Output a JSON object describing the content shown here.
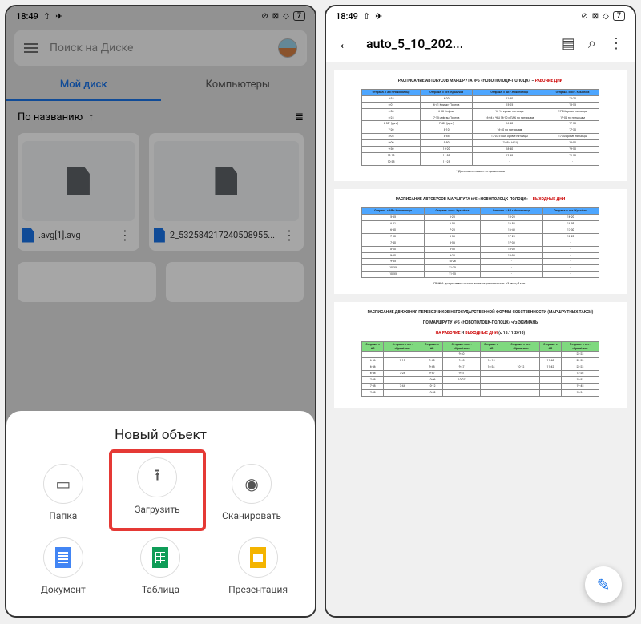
{
  "status": {
    "time": "18:49",
    "battery": "7"
  },
  "drive": {
    "search_placeholder": "Поиск на Диске",
    "tabs": {
      "mydisk": "Мой диск",
      "computers": "Компьютеры"
    },
    "sort_label": "По названию",
    "files": [
      {
        "name": ".avg[1].avg"
      },
      {
        "name": "2_532584217240508955..."
      }
    ]
  },
  "sheet": {
    "title": "Новый объект",
    "items": {
      "folder": "Папка",
      "upload": "Загрузить",
      "scan": "Сканировать",
      "doc": "Документ",
      "table": "Таблица",
      "presentation": "Презентация"
    }
  },
  "viewer": {
    "filename": "auto_5_10_202...",
    "page1": {
      "title_a": "РАСПИСАНИЕ АВТОБУСОВ МАРШРУТА №5 «НОВОПОЛОЦК-ПОЛОЦК» – ",
      "title_b": "РАБОЧИЕ ДНИ",
      "headers": [
        "Отправл. с АВ г.Новополоцк",
        "Отправл. с ост. Крынiчка",
        "Отправл. с АВ г.Новополоцк",
        "Отправл. с ост. Крынiчка"
      ],
      "rows": [
        [
          "5-35",
          "6-20",
          "11-30",
          "12-20"
        ],
        [
          "6-01",
          "6-41 Климо- Почтов",
          "15-05",
          "15-55"
        ],
        [
          "6-08",
          "6-58 Нефтан",
          "16-14 кроме пятницы",
          "17-04 кроме пятницы"
        ],
        [
          "6-25",
          "7-15 нефтан Почтов",
          "16-04 с ЧЩ 16-10 с ПАК по пятницам",
          "17-04 по пятницам"
        ],
        [
          "6-50* (дач.)",
          "7-40* (дач.)",
          "16-40",
          "17-30"
        ],
        [
          "7-20",
          "8-10",
          "16-40 по пятницам",
          "17-30"
        ],
        [
          "8-05",
          "8-55",
          "17-07 с ПАК кроме пятницы",
          "17-30 кроме пятницы"
        ],
        [
          "9-00",
          "9-50",
          "17-05 с НГЩ",
          "18-00"
        ],
        [
          "9-30",
          "10-20",
          "18-40",
          "19-50"
        ],
        [
          "10-10",
          "11-00",
          "19-30",
          "19-50"
        ],
        [
          "10-35",
          "11-25",
          "-",
          "-"
        ]
      ],
      "footnote": "* Дополнительные отправления"
    },
    "page2": {
      "title_a": "РАСПИСАНИЕ АВТОБУСОВ МАРШРУТА №5 «НОВОПОЛОЦК-ПОЛОЦК» – ",
      "title_b": "ВЫХОДНЫЕ ДНИ",
      "rows": [
        [
          "5-35",
          "6-20",
          "15-20",
          "16-20"
        ],
        [
          "6-01",
          "6-50",
          "16-00",
          "16-50"
        ],
        [
          "6-30",
          "7-20",
          "16-40",
          "17-30"
        ],
        [
          "7-00",
          "8-35",
          "17-20",
          "18-20"
        ],
        [
          "7-40",
          "8-53",
          "17-30",
          "-"
        ],
        [
          "8-00",
          "8-50",
          "18-00",
          "-"
        ],
        [
          "9-30",
          "9-20",
          "18-50",
          "-"
        ],
        [
          "9-35",
          "10-26",
          "-",
          "-"
        ],
        [
          "10-35",
          "11-25",
          "-",
          "-"
        ],
        [
          "10-55",
          "11-55",
          "-",
          "-"
        ]
      ],
      "footnote": "ПРИМ: допустимое отклонение от расписания: +3 мин;-5 мин."
    },
    "page3": {
      "title_a": "РАСПИСАНИЕ ДВИЖЕНИЯ ПЕРЕВОЗЧИКОВ НЕГОСУДАРСТВЕННОЙ ФОРМЫ СОБСТВЕННОСТИ (МАРШРУТНЫХ ТАКСИ)",
      "title_b": "ПО МАРШРУТУ №5 «НОВОПОЛОЦК-ПОЛОЦК» ч/з ЭКИМАНЬ",
      "title_c": "НА РАБОЧИЕ И ВЫХОДНЫЕ ДНИ (с 15.11.2018)",
      "headers": [
        "Отправл. с АВ",
        "Отправл. с ост. «Крынiчка»",
        "Отправл. с АВ",
        "Отправл. с ост. «Крынiчка»",
        "Отправл. с АВ",
        "Отправл. с ост. «Крынiчка»",
        "Отправл. с АВ",
        "Отправл. с ост. «Крынiчка»"
      ],
      "rows": [
        [
          "",
          "",
          "",
          "9-40",
          "",
          "",
          "",
          "22-22"
        ],
        [
          "6-36",
          "7-15",
          "9-40",
          "9-45",
          "16-15",
          "",
          "11-48",
          "22-22"
        ],
        [
          "6-46",
          "",
          "9-48",
          "9-47",
          "16-34",
          "10-12",
          "11-42",
          "22-22"
        ],
        [
          "6-46",
          "7-28",
          "9-57",
          "9-51",
          "",
          "",
          "",
          "12-26"
        ],
        [
          "7-08",
          "",
          "10-06",
          "10-07",
          "",
          "",
          "",
          "19-51"
        ],
        [
          "7-08",
          "7-44",
          "10-12",
          "",
          "",
          "",
          "",
          "19-45"
        ],
        [
          "7-08",
          "",
          "10-28",
          "",
          "",
          "",
          "",
          "19-34"
        ]
      ]
    }
  }
}
